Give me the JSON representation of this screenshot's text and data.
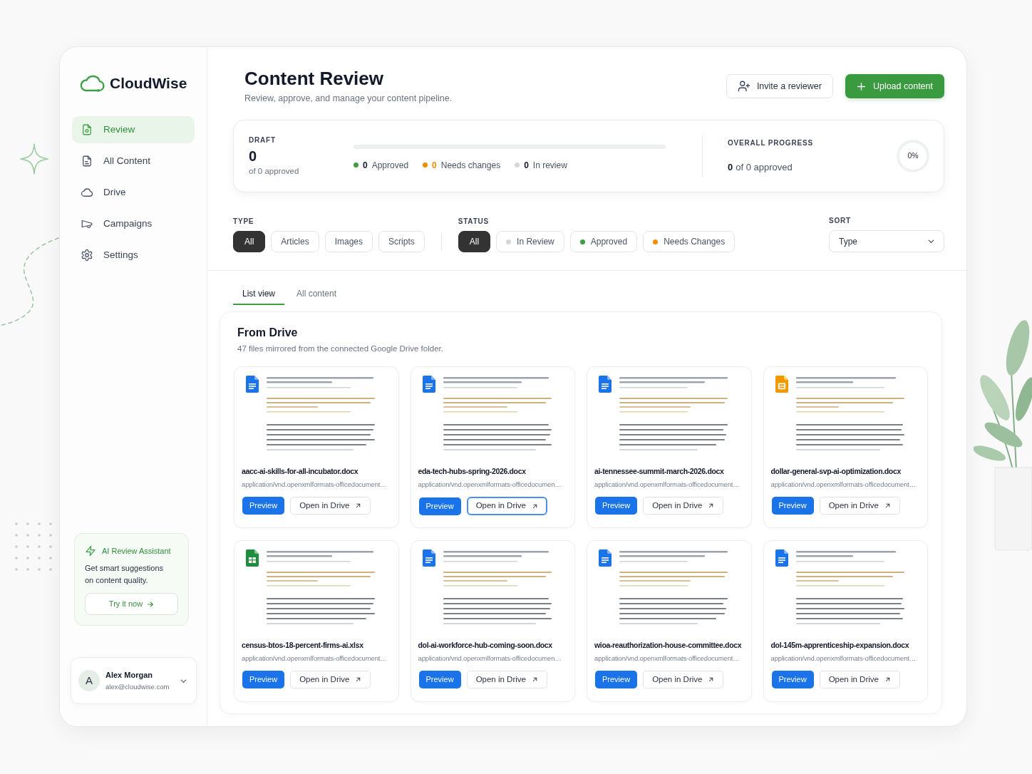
{
  "sidebar": {
    "logo": "CloudWise",
    "nav": [
      {
        "label": "Review",
        "selected": true,
        "kind": "review"
      },
      {
        "label": "All Content",
        "selected": false,
        "kind": "content"
      },
      {
        "label": "Drive",
        "selected": false,
        "kind": "drive"
      },
      {
        "label": "Campaigns",
        "selected": false,
        "kind": "campaigns"
      },
      {
        "label": "Settings",
        "selected": false,
        "kind": "settings"
      }
    ],
    "assistant": {
      "title": "AI Review Assistant",
      "text": "Get smart suggestions on content quality.",
      "button": "Try it now"
    },
    "user": {
      "initial": "A",
      "name": "Alex Morgan",
      "email": "alex@cloudwise.com"
    }
  },
  "header": {
    "title": "Content Review",
    "subtitle": "Review, approve, and manage your content pipeline.",
    "buttons": [
      {
        "label": "Invite a reviewer",
        "kind": "secondary"
      },
      {
        "label": "Upload content",
        "kind": "primary"
      }
    ]
  },
  "stats": {
    "draft": {
      "label": "DRAFT",
      "value": "0",
      "caption": "of 0 approved",
      "legend": [
        {
          "count": "0",
          "label": "Approved",
          "color": "#3f9f45",
          "highlight": false
        },
        {
          "count": "0",
          "label": "Needs changes",
          "color": "#f08c00",
          "highlight": true
        },
        {
          "count": "0",
          "label": "In review",
          "color": "#d4d6d8",
          "highlight": false
        }
      ]
    },
    "overall": {
      "label": "OVERALL PROGRESS",
      "count": "0",
      "text": "of 0 approved",
      "percent": "0%"
    }
  },
  "filters": {
    "type": {
      "label": "TYPE",
      "chips": [
        {
          "label": "All",
          "selected": true
        },
        {
          "label": "Articles",
          "selected": false
        },
        {
          "label": "Images",
          "selected": false
        },
        {
          "label": "Scripts",
          "selected": false
        }
      ]
    },
    "status": {
      "label": "STATUS",
      "chips": [
        {
          "label": "All",
          "selected": true
        },
        {
          "label": "In Review",
          "selected": false,
          "color": "#d4d6d8"
        },
        {
          "label": "Approved",
          "selected": false,
          "color": "#3f9f45"
        },
        {
          "label": "Needs Changes",
          "selected": false,
          "color": "#f08c00"
        }
      ]
    },
    "sort": {
      "label": "SORT",
      "value": "Type"
    }
  },
  "tabs": [
    {
      "label": "List view",
      "selected": true
    },
    {
      "label": "All content",
      "selected": false
    }
  ],
  "section": {
    "title": "From Drive",
    "subtitle": "47 files mirrored from the connected Google Drive folder.",
    "files": [
      {
        "name": "aacc-ai-skills-for-all-incubator.docx",
        "mime": "application/vnd.openxmlformats-officedocument…",
        "kind": "doc",
        "preview": "Preview",
        "open": "Open in Drive",
        "open_focused": false
      },
      {
        "name": "eda-tech-hubs-spring-2026.docx",
        "mime": "application/vnd.openxmlformats-officedocumen…",
        "kind": "doc",
        "preview": "Preview",
        "open": "Open in Drive",
        "open_focused": true
      },
      {
        "name": "ai-tennessee-summit-march-2026.docx",
        "mime": "application/vnd.openxmlformats-officedocument…",
        "kind": "doc",
        "preview": "Preview",
        "open": "Open in Drive",
        "open_focused": false
      },
      {
        "name": "dollar-general-svp-ai-optimization.docx",
        "mime": "application/vnd.openxmlformats-officedocument…",
        "kind": "slides",
        "preview": "Preview",
        "open": "Open in Drive",
        "open_focused": false
      },
      {
        "name": "census-btos-18-percent-firms-ai.xlsx",
        "mime": "application/vnd.openxmlformats-officedocument…",
        "kind": "sheet",
        "preview": "Preview",
        "open": "Open in Drive",
        "open_focused": false
      },
      {
        "name": "dol-ai-workforce-hub-coming-soon.docx",
        "mime": "application/vnd.openxmlformats-officedocumen…",
        "kind": "doc",
        "preview": "Preview",
        "open": "Open in Drive",
        "open_focused": false
      },
      {
        "name": "wioa-reauthorization-house-committee.docx",
        "mime": "application/vnd.openxmlformats-officedocument…",
        "kind": "doc",
        "preview": "Preview",
        "open": "Open in Drive",
        "open_focused": false
      },
      {
        "name": "dol-145m-apprenticeship-expansion.docx",
        "mime": "application/vnd.openxmlformats-officedocument…",
        "kind": "doc",
        "preview": "Preview",
        "open": "Open in Drive",
        "open_focused": false
      }
    ]
  }
}
